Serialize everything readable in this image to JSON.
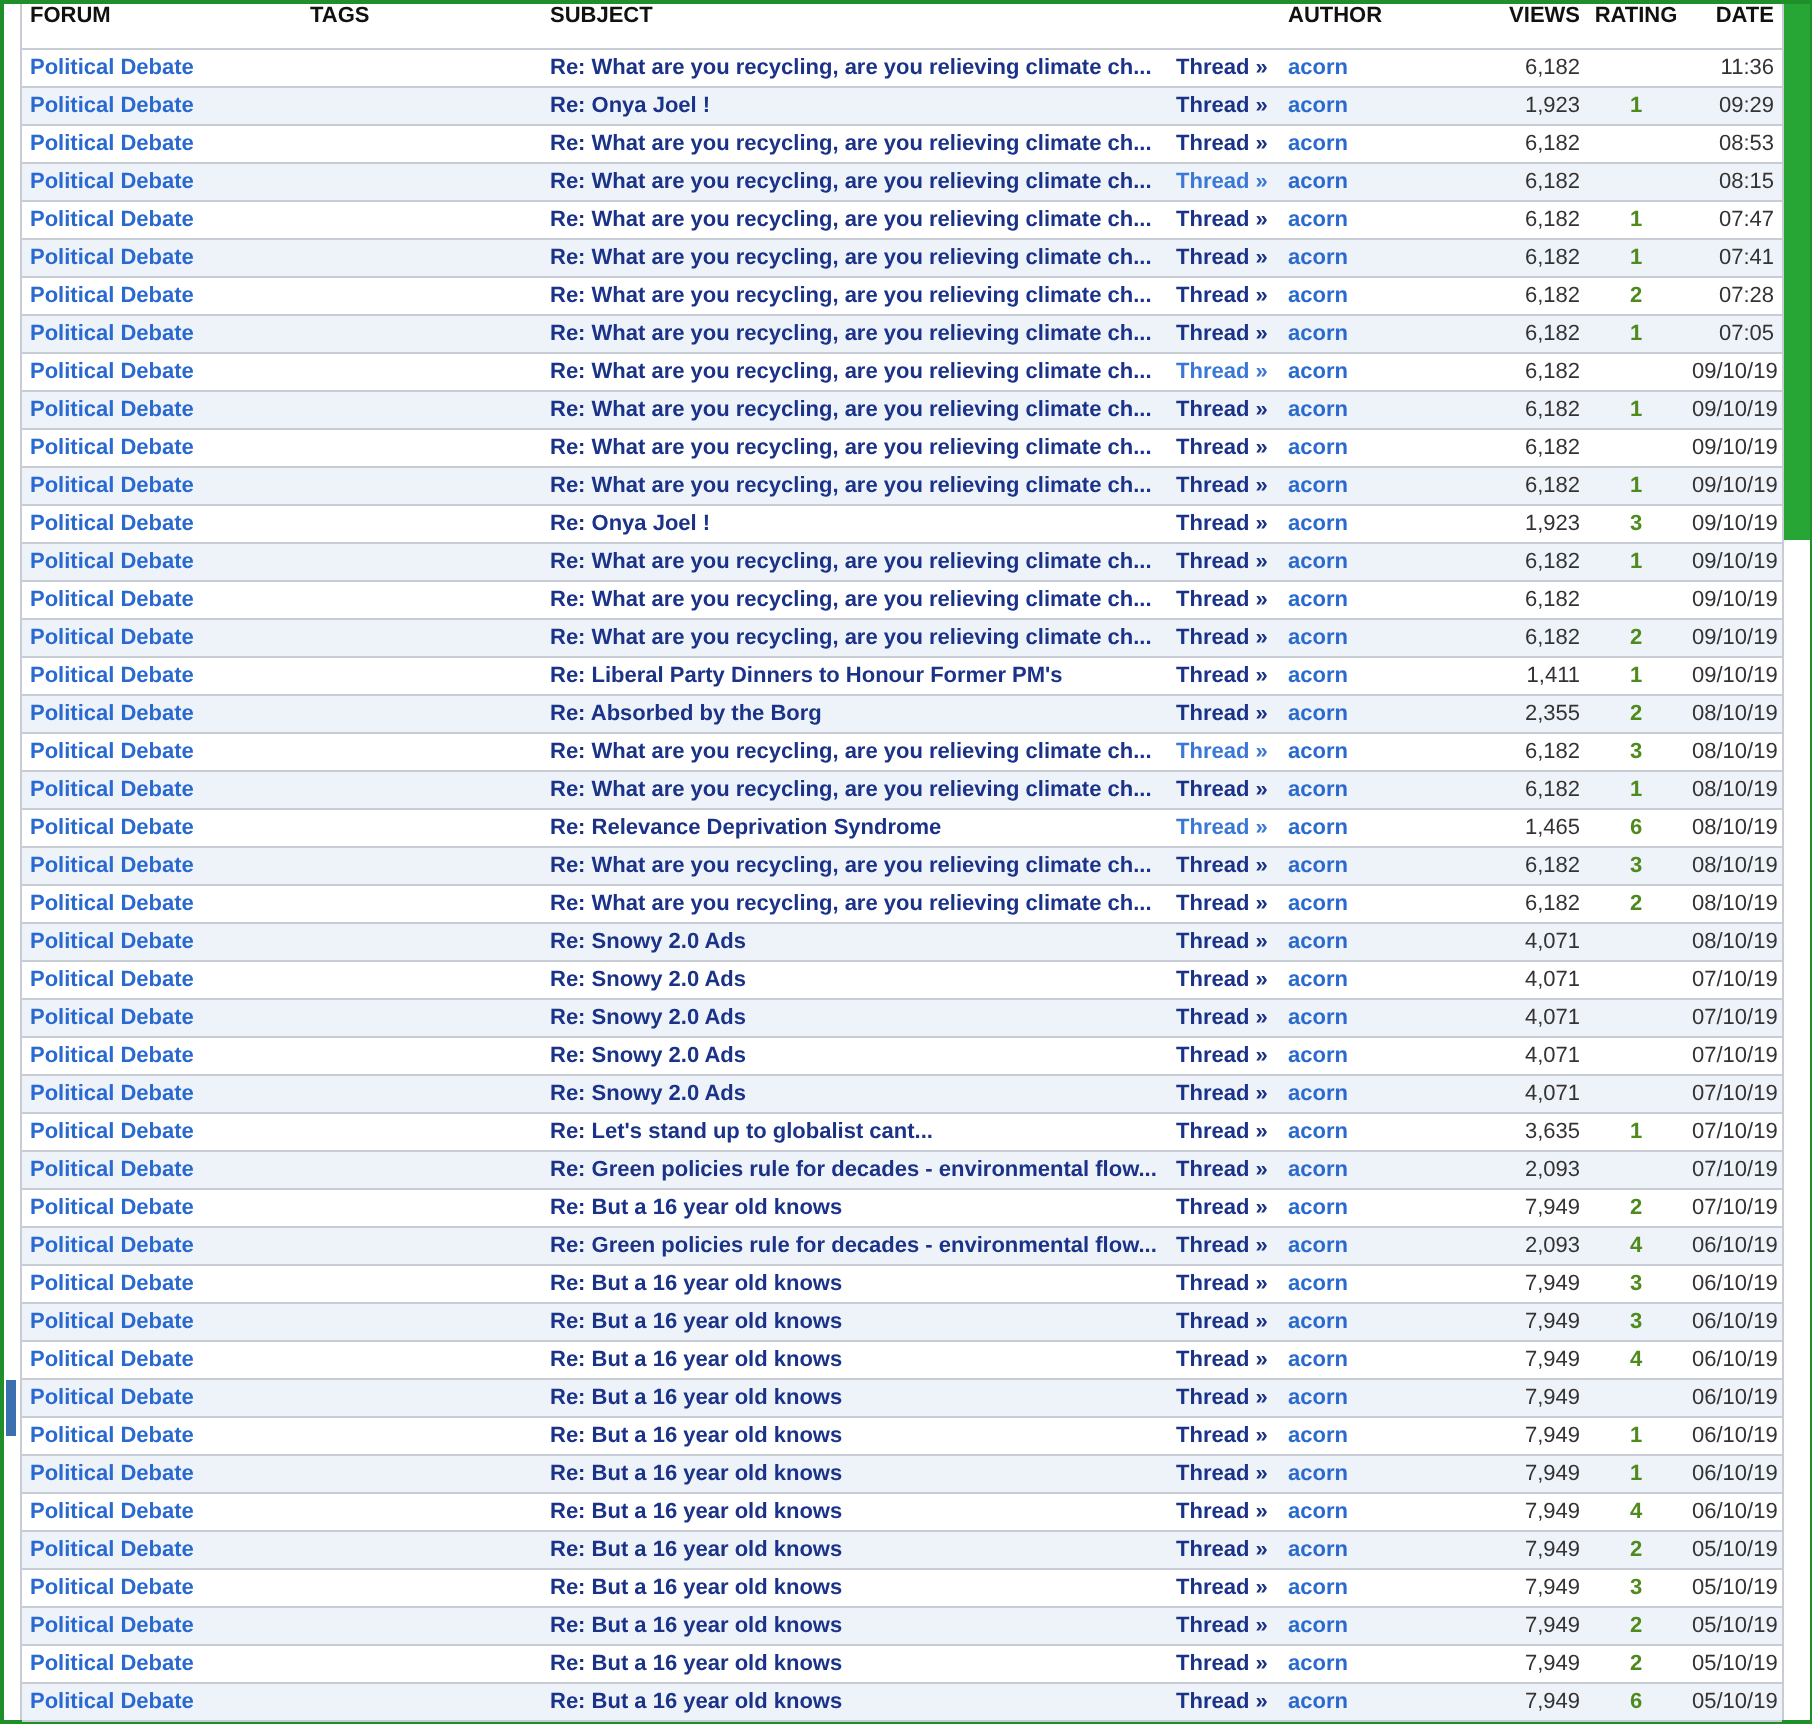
{
  "columns": [
    "FORUM",
    "TAGS",
    "SUBJECT",
    "AUTHOR",
    "VIEWS",
    "RATING",
    "DATE"
  ],
  "rows": [
    {
      "forum": "Political Debate",
      "subject": "Re: What are you recycling, are you relieving climate ch...",
      "thread": "Thread »",
      "visited": true,
      "author": "acorn",
      "views": "6,182",
      "date": "11:36"
    },
    {
      "forum": "Political Debate",
      "subject": "Re: Onya Joel !",
      "thread": "Thread »",
      "visited": true,
      "author": "acorn",
      "views": "1,923",
      "rating": "1",
      "date": "09:29"
    },
    {
      "forum": "Political Debate",
      "subject": "Re: What are you recycling, are you relieving climate ch...",
      "thread": "Thread »",
      "visited": true,
      "author": "acorn",
      "views": "6,182",
      "date": "08:53"
    },
    {
      "forum": "Political Debate",
      "subject": "Re: What are you recycling, are you relieving climate ch...",
      "thread": "Thread »",
      "visited": false,
      "author": "acorn",
      "views": "6,182",
      "date": "08:15"
    },
    {
      "forum": "Political Debate",
      "subject": "Re: What are you recycling, are you relieving climate ch...",
      "thread": "Thread »",
      "visited": true,
      "author": "acorn",
      "views": "6,182",
      "rating": "1",
      "date": "07:47"
    },
    {
      "forum": "Political Debate",
      "subject": "Re: What are you recycling, are you relieving climate ch...",
      "thread": "Thread »",
      "visited": true,
      "author": "acorn",
      "views": "6,182",
      "rating": "1",
      "date": "07:41"
    },
    {
      "forum": "Political Debate",
      "subject": "Re: What are you recycling, are you relieving climate ch...",
      "thread": "Thread »",
      "visited": true,
      "author": "acorn",
      "views": "6,182",
      "rating": "2",
      "date": "07:28"
    },
    {
      "forum": "Political Debate",
      "subject": "Re: What are you recycling, are you relieving climate ch...",
      "thread": "Thread »",
      "visited": true,
      "author": "acorn",
      "views": "6,182",
      "rating": "1",
      "date": "07:05"
    },
    {
      "forum": "Political Debate",
      "subject": "Re: What are you recycling, are you relieving climate ch...",
      "thread": "Thread »",
      "visited": false,
      "author": "acorn",
      "views": "6,182",
      "date": "09/10/19"
    },
    {
      "forum": "Political Debate",
      "subject": "Re: What are you recycling, are you relieving climate ch...",
      "thread": "Thread »",
      "visited": true,
      "author": "acorn",
      "views": "6,182",
      "rating": "1",
      "date": "09/10/19"
    },
    {
      "forum": "Political Debate",
      "subject": "Re: What are you recycling, are you relieving climate ch...",
      "thread": "Thread »",
      "visited": true,
      "author": "acorn",
      "views": "6,182",
      "date": "09/10/19"
    },
    {
      "forum": "Political Debate",
      "subject": "Re: What are you recycling, are you relieving climate ch...",
      "thread": "Thread »",
      "visited": true,
      "author": "acorn",
      "views": "6,182",
      "rating": "1",
      "date": "09/10/19"
    },
    {
      "forum": "Political Debate",
      "subject": "Re: Onya Joel !",
      "thread": "Thread »",
      "visited": true,
      "author": "acorn",
      "views": "1,923",
      "rating": "3",
      "date": "09/10/19"
    },
    {
      "forum": "Political Debate",
      "subject": "Re: What are you recycling, are you relieving climate ch...",
      "thread": "Thread »",
      "visited": true,
      "author": "acorn",
      "views": "6,182",
      "rating": "1",
      "date": "09/10/19"
    },
    {
      "forum": "Political Debate",
      "subject": "Re: What are you recycling, are you relieving climate ch...",
      "thread": "Thread »",
      "visited": true,
      "author": "acorn",
      "views": "6,182",
      "date": "09/10/19"
    },
    {
      "forum": "Political Debate",
      "subject": "Re: What are you recycling, are you relieving climate ch...",
      "thread": "Thread »",
      "visited": true,
      "author": "acorn",
      "views": "6,182",
      "rating": "2",
      "date": "09/10/19"
    },
    {
      "forum": "Political Debate",
      "subject": "Re: Liberal Party Dinners to Honour Former PM's",
      "thread": "Thread »",
      "visited": true,
      "author": "acorn",
      "views": "1,411",
      "rating": "1",
      "date": "09/10/19"
    },
    {
      "forum": "Political Debate",
      "subject": "Re: Absorbed by the Borg",
      "thread": "Thread »",
      "visited": true,
      "author": "acorn",
      "views": "2,355",
      "rating": "2",
      "date": "08/10/19"
    },
    {
      "forum": "Political Debate",
      "subject": "Re: What are you recycling, are you relieving climate ch...",
      "thread": "Thread »",
      "visited": false,
      "author": "acorn",
      "views": "6,182",
      "rating": "3",
      "date": "08/10/19"
    },
    {
      "forum": "Political Debate",
      "subject": "Re: What are you recycling, are you relieving climate ch...",
      "thread": "Thread »",
      "visited": true,
      "author": "acorn",
      "views": "6,182",
      "rating": "1",
      "date": "08/10/19"
    },
    {
      "forum": "Political Debate",
      "subject": "Re: Relevance Deprivation Syndrome",
      "thread": "Thread »",
      "visited": false,
      "author": "acorn",
      "views": "1,465",
      "rating": "6",
      "date": "08/10/19"
    },
    {
      "forum": "Political Debate",
      "subject": "Re: What are you recycling, are you relieving climate ch...",
      "thread": "Thread »",
      "visited": true,
      "author": "acorn",
      "views": "6,182",
      "rating": "3",
      "date": "08/10/19"
    },
    {
      "forum": "Political Debate",
      "subject": "Re: What are you recycling, are you relieving climate ch...",
      "thread": "Thread »",
      "visited": true,
      "author": "acorn",
      "views": "6,182",
      "rating": "2",
      "date": "08/10/19"
    },
    {
      "forum": "Political Debate",
      "subject": "Re: Snowy 2.0 Ads",
      "thread": "Thread »",
      "visited": true,
      "author": "acorn",
      "views": "4,071",
      "date": "08/10/19"
    },
    {
      "forum": "Political Debate",
      "subject": "Re: Snowy 2.0 Ads",
      "thread": "Thread »",
      "visited": true,
      "author": "acorn",
      "views": "4,071",
      "date": "07/10/19"
    },
    {
      "forum": "Political Debate",
      "subject": "Re: Snowy 2.0 Ads",
      "thread": "Thread »",
      "visited": true,
      "author": "acorn",
      "views": "4,071",
      "date": "07/10/19"
    },
    {
      "forum": "Political Debate",
      "subject": "Re: Snowy 2.0 Ads",
      "thread": "Thread »",
      "visited": true,
      "author": "acorn",
      "views": "4,071",
      "date": "07/10/19"
    },
    {
      "forum": "Political Debate",
      "subject": "Re: Snowy 2.0 Ads",
      "thread": "Thread »",
      "visited": true,
      "author": "acorn",
      "views": "4,071",
      "date": "07/10/19"
    },
    {
      "forum": "Political Debate",
      "subject": "Re: Let's stand up to globalist cant...",
      "thread": "Thread »",
      "visited": true,
      "author": "acorn",
      "views": "3,635",
      "rating": "1",
      "date": "07/10/19"
    },
    {
      "forum": "Political Debate",
      "subject": "Re: Green policies rule for decades - environmental flow...",
      "thread": "Thread »",
      "visited": true,
      "author": "acorn",
      "views": "2,093",
      "date": "07/10/19"
    },
    {
      "forum": "Political Debate",
      "subject": "Re: But a 16 year old knows",
      "thread": "Thread »",
      "visited": true,
      "author": "acorn",
      "views": "7,949",
      "rating": "2",
      "date": "07/10/19"
    },
    {
      "forum": "Political Debate",
      "subject": "Re: Green policies rule for decades - environmental flow...",
      "thread": "Thread »",
      "visited": true,
      "author": "acorn",
      "views": "2,093",
      "rating": "4",
      "date": "06/10/19"
    },
    {
      "forum": "Political Debate",
      "subject": "Re: But a 16 year old knows",
      "thread": "Thread »",
      "visited": true,
      "author": "acorn",
      "views": "7,949",
      "rating": "3",
      "date": "06/10/19"
    },
    {
      "forum": "Political Debate",
      "subject": "Re: But a 16 year old knows",
      "thread": "Thread »",
      "visited": true,
      "author": "acorn",
      "views": "7,949",
      "rating": "3",
      "date": "06/10/19"
    },
    {
      "forum": "Political Debate",
      "subject": "Re: But a 16 year old knows",
      "thread": "Thread »",
      "visited": true,
      "author": "acorn",
      "views": "7,949",
      "rating": "4",
      "date": "06/10/19"
    },
    {
      "forum": "Political Debate",
      "subject": "Re: But a 16 year old knows",
      "thread": "Thread »",
      "visited": true,
      "author": "acorn",
      "views": "7,949",
      "date": "06/10/19"
    },
    {
      "forum": "Political Debate",
      "subject": "Re: But a 16 year old knows",
      "thread": "Thread »",
      "visited": true,
      "author": "acorn",
      "views": "7,949",
      "rating": "1",
      "date": "06/10/19"
    },
    {
      "forum": "Political Debate",
      "subject": "Re: But a 16 year old knows",
      "thread": "Thread »",
      "visited": true,
      "author": "acorn",
      "views": "7,949",
      "rating": "1",
      "date": "06/10/19"
    },
    {
      "forum": "Political Debate",
      "subject": "Re: But a 16 year old knows",
      "thread": "Thread »",
      "visited": true,
      "author": "acorn",
      "views": "7,949",
      "rating": "4",
      "date": "06/10/19"
    },
    {
      "forum": "Political Debate",
      "subject": "Re: But a 16 year old knows",
      "thread": "Thread »",
      "visited": true,
      "author": "acorn",
      "views": "7,949",
      "rating": "2",
      "date": "05/10/19"
    },
    {
      "forum": "Political Debate",
      "subject": "Re: But a 16 year old knows",
      "thread": "Thread »",
      "visited": true,
      "author": "acorn",
      "views": "7,949",
      "rating": "3",
      "date": "05/10/19"
    },
    {
      "forum": "Political Debate",
      "subject": "Re: But a 16 year old knows",
      "thread": "Thread »",
      "visited": true,
      "author": "acorn",
      "views": "7,949",
      "rating": "2",
      "date": "05/10/19"
    },
    {
      "forum": "Political Debate",
      "subject": "Re: But a 16 year old knows",
      "thread": "Thread »",
      "visited": true,
      "author": "acorn",
      "views": "7,949",
      "rating": "2",
      "date": "05/10/19"
    },
    {
      "forum": "Political Debate",
      "subject": "Re: But a 16 year old knows",
      "thread": "Thread »",
      "visited": true,
      "author": "acorn",
      "views": "7,949",
      "rating": "6",
      "date": "05/10/19"
    }
  ]
}
